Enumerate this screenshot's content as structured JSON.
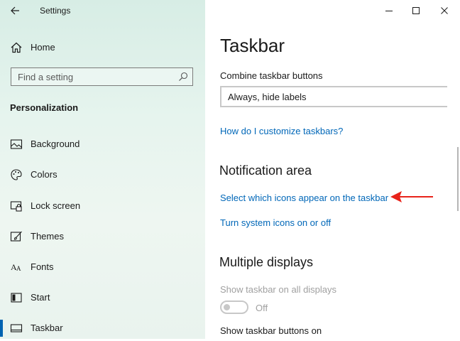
{
  "app": {
    "title": "Settings"
  },
  "sidebar": {
    "home_label": "Home",
    "search_placeholder": "Find a setting",
    "section_heading": "Personalization",
    "items": [
      {
        "label": "Background",
        "icon": "picture-icon"
      },
      {
        "label": "Colors",
        "icon": "palette-icon"
      },
      {
        "label": "Lock screen",
        "icon": "lock-screen-icon"
      },
      {
        "label": "Themes",
        "icon": "brush-icon"
      },
      {
        "label": "Fonts",
        "icon": "font-icon"
      },
      {
        "label": "Start",
        "icon": "start-icon"
      },
      {
        "label": "Taskbar",
        "icon": "taskbar-icon",
        "active": true
      }
    ]
  },
  "main": {
    "title": "Taskbar",
    "combine_label": "Combine taskbar buttons",
    "combine_value": "Always, hide labels",
    "customize_link": "How do I customize taskbars?",
    "notification_heading": "Notification area",
    "select_icons_link": "Select which icons appear on the taskbar",
    "system_icons_link": "Turn system icons on or off",
    "multiple_displays_heading": "Multiple displays",
    "show_all_displays_label": "Show taskbar on all displays",
    "show_all_displays_state": "Off",
    "show_buttons_on_label": "Show taskbar buttons on"
  },
  "colors": {
    "accent": "#0063b1",
    "link": "#0067b8",
    "annotation_arrow": "#e8231a"
  }
}
